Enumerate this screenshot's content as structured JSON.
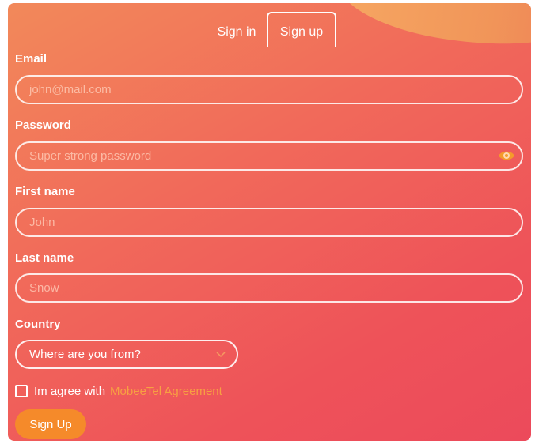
{
  "tabs": {
    "signin_label": "Sign in",
    "signup_label": "Sign up",
    "active": "signup"
  },
  "email": {
    "label": "Email",
    "placeholder": "john@mail.com",
    "value": ""
  },
  "password": {
    "label": "Password",
    "placeholder": "Super strong password",
    "value": "",
    "toggle_icon": "eye-icon"
  },
  "first_name": {
    "label": "First name",
    "placeholder": "John",
    "value": ""
  },
  "last_name": {
    "label": "Last name",
    "placeholder": "Snow",
    "value": ""
  },
  "country": {
    "label": "Country",
    "selected": "Where are you from?",
    "icon": "chevron-down-icon"
  },
  "agreement": {
    "text": "Im agree with",
    "link": "MobeeTel Agreement",
    "checked": false
  },
  "submit": {
    "label": "Sign Up"
  },
  "colors": {
    "gradient_start": "#f2895a",
    "gradient_end": "#ec4a5b",
    "accent": "#f58a2a",
    "link": "#f7a042",
    "text": "#ffffff"
  }
}
